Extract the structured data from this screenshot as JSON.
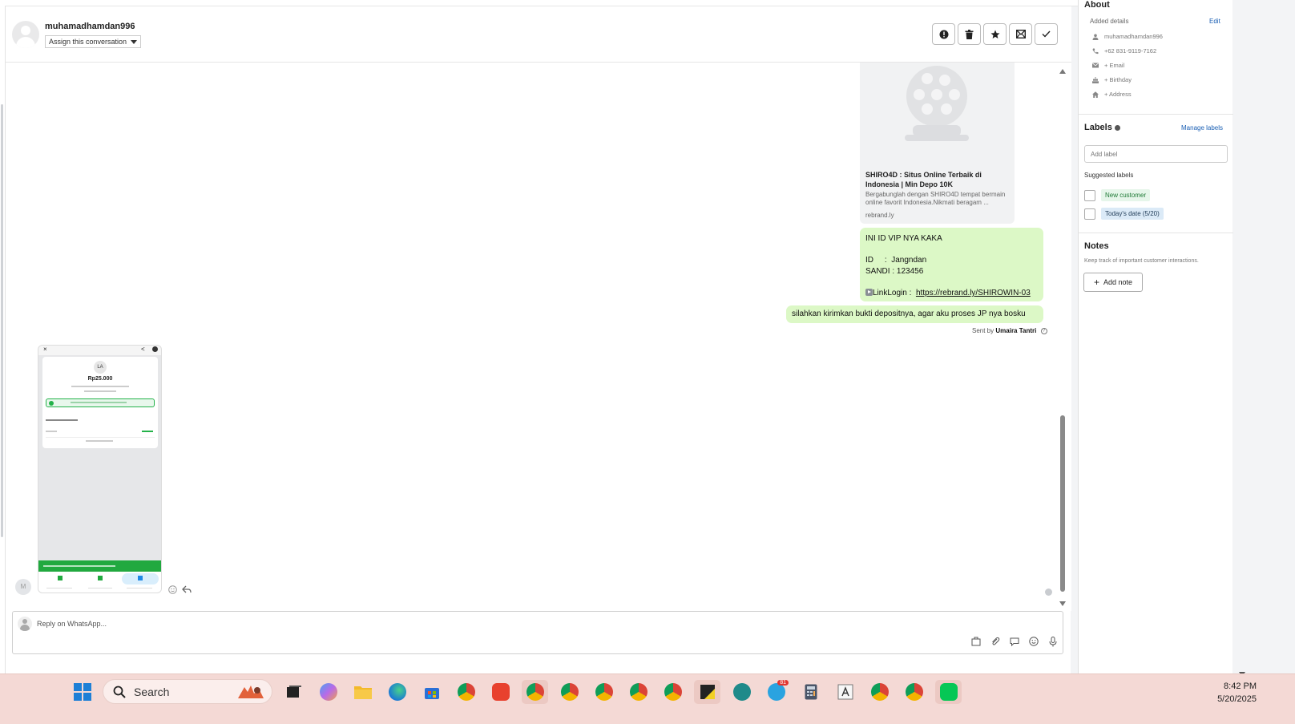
{
  "conversation": {
    "contact_name": "muhamadhamdan996",
    "assign_label": "Assign this conversation",
    "header_buttons": [
      "info-icon",
      "trash-icon",
      "star-icon",
      "mark-unread-icon",
      "check-icon"
    ]
  },
  "messages": {
    "link_preview": {
      "title": "SHIRO4D : Situs Online Terbaik di Indonesia | Min Depo 10K",
      "description": "Bergabunglah dengan SHIRO4D tempat bermain online favorit Indonesia.Nikmati beragam ...",
      "domain": "rebrand.ly"
    },
    "vip_message": {
      "line1": "INI ID VIP NYA KAKA",
      "line2": "ID     :  Jangndan",
      "line3": "SANDI : 123456",
      "link_label": "LinkLogin :",
      "link_url": "https://rebrand.ly/SHIROWIN-03"
    },
    "deposit_message": "silahkan kirimkan bukti depositnya, agar aku proses JP nya bosku",
    "sent_by_prefix": "Sent by",
    "sent_by_name": "Umaira Tantri",
    "incoming_avatar_initial": "M",
    "screenshot": {
      "initials": "LA",
      "amount": "Rp25.000"
    }
  },
  "composer": {
    "placeholder": "Reply on WhatsApp..."
  },
  "sidebar": {
    "about_title": "About",
    "added_details": "Added details",
    "edit_label": "Edit",
    "about_rows": [
      {
        "icon": "person-icon",
        "text": "muhamadhamdan996"
      },
      {
        "icon": "phone-icon",
        "text": "+62 831-9119-7162"
      },
      {
        "icon": "email-icon",
        "text": "+ Email"
      },
      {
        "icon": "cake-icon",
        "text": "+ Birthday"
      },
      {
        "icon": "home-icon",
        "text": "+ Address"
      }
    ],
    "labels_title": "Labels",
    "manage_labels": "Manage labels",
    "add_label_placeholder": "Add label",
    "suggested_labels_title": "Suggested labels",
    "suggested_labels": [
      {
        "text": "New customer",
        "bg": "#e6f6ea",
        "color": "#1f7a36"
      },
      {
        "text": "Today's date (5/20)",
        "bg": "#dbeaf7",
        "color": "#1e3a56"
      }
    ],
    "notes_title": "Notes",
    "notes_subtitle": "Keep track of important customer interactions.",
    "add_note": "Add note"
  },
  "taskbar": {
    "search_label": "Search",
    "telegram_badge": "81",
    "time": "8:42 PM",
    "date": "5/20/2025"
  },
  "colors": {
    "bubble_green": "#dcf8c6",
    "accent_blue": "#1a5fb4",
    "taskbar_bg": "#f4d9d5"
  }
}
